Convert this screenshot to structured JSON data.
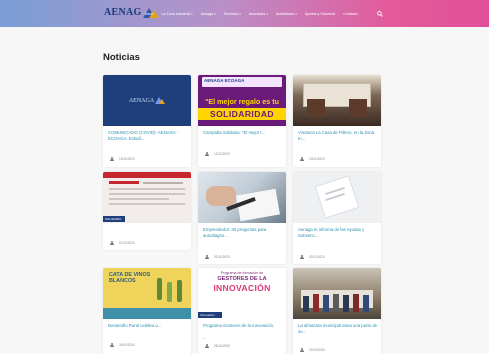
{
  "header": {
    "logo_text": "AENAG",
    "menu": [
      {
        "label": "Inicio",
        "has_caret": false
      },
      {
        "label": "La Zona Industrial",
        "has_caret": true
      },
      {
        "label": "Aenaga",
        "has_caret": true
      },
      {
        "label": "Servicios",
        "has_caret": true
      },
      {
        "label": "Asociados",
        "has_caret": true
      },
      {
        "label": "Actividades",
        "has_caret": true
      },
      {
        "label": "Ayudas y Subvenci",
        "has_caret": false
      },
      {
        "label": "Contacto",
        "has_caret": false
      }
    ],
    "search_icon": "search-icon"
  },
  "main": {
    "title": "Noticias",
    "cards": [
      {
        "title": "COMUNICADO (COVID)- AENAGA - ECOAGA. Estudi...",
        "date": "19/11/2020",
        "image_text": "AENAGA"
      },
      {
        "title": "Campaña Solidaria: \"El mejor r...",
        "date": "10/11/2020",
        "image_text_top": "AENAGA  ECOAGA",
        "image_text_mid": "\"El mejor regalo es tu",
        "image_text_big": "SOLIDARIDAD"
      },
      {
        "title": "Vinoteca La Casa de Piñero, en la Zona In...",
        "date": "10/11/2020"
      },
      {
        "title": "",
        "date": "07/11/2020",
        "image_tag": "SOLIDARIO"
      },
      {
        "title": "Emprendedor: 30 preguntas para autodiagno...",
        "date": "02/11/2020"
      },
      {
        "title": "Aenaga te informa de las Ayudas y Subvenc...",
        "date": "02/11/2020"
      },
      {
        "title": "Desarrollo Rural celebra u...",
        "date": "30/10/2020",
        "image_text": "CATA DE VINOS BLANCOS"
      },
      {
        "title": "Programa Gestores de la Innovación.",
        "title_extra": "...",
        "date": "26/10/2020",
        "image_text_top": "Programa de formación de",
        "image_text_mid": "GESTORES DE LA",
        "image_text_big": "INNOVACIÓN",
        "image_tag": "Innovación"
      },
      {
        "title": "La almazara municipal dona una parte de su...",
        "date": "22/10/2020"
      }
    ]
  }
}
